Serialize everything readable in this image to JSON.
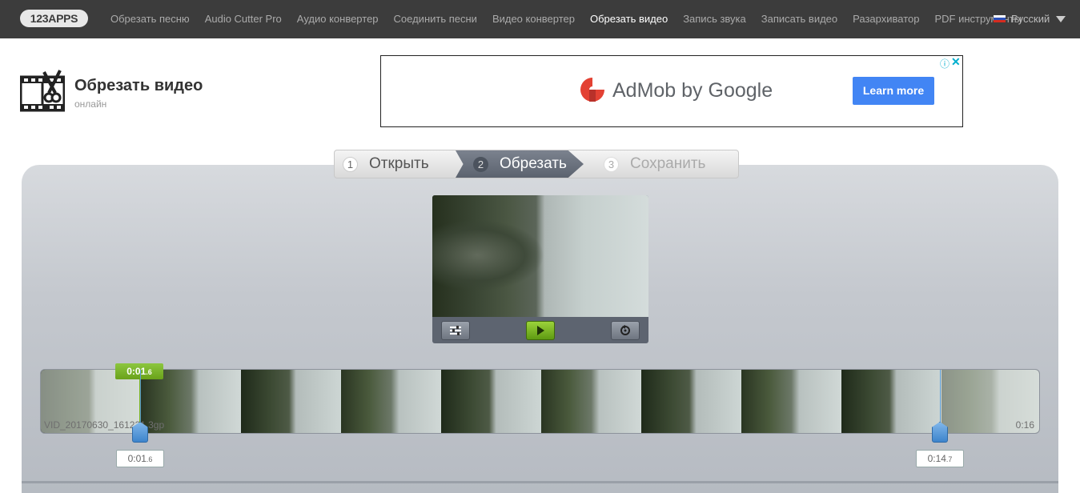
{
  "nav": {
    "logo": "123APPS",
    "items": [
      {
        "label": "Обрезать песню",
        "active": false
      },
      {
        "label": "Audio Cutter Pro",
        "active": false
      },
      {
        "label": "Аудио конвертер",
        "active": false
      },
      {
        "label": "Соединить песни",
        "active": false
      },
      {
        "label": "Видео конвертер",
        "active": false
      },
      {
        "label": "Обрезать видео",
        "active": true
      },
      {
        "label": "Запись звука",
        "active": false
      },
      {
        "label": "Записать видео",
        "active": false
      },
      {
        "label": "Разархиватор",
        "active": false
      },
      {
        "label": "PDF инструменты",
        "active": false
      }
    ],
    "language": "Русский"
  },
  "app": {
    "title": "Обрезать видео",
    "subtitle": "онлайн",
    "icon": "film-scissors-icon"
  },
  "ad": {
    "brand": "AdMob by Google",
    "button": "Learn more",
    "info_icon": "ⓘ",
    "close_icon": "✕"
  },
  "steps": [
    {
      "num": "1",
      "label": "Открыть"
    },
    {
      "num": "2",
      "label": "Обрезать"
    },
    {
      "num": "3",
      "label": "Сохранить"
    }
  ],
  "player": {
    "controls": [
      "settings-icon",
      "play-icon",
      "reset-icon"
    ]
  },
  "timeline": {
    "filename": "VID_20170630_161221.3gp",
    "duration": "0:16",
    "cursor": {
      "main": "0:01",
      "frac": ".6"
    },
    "start": {
      "main": "0:01",
      "frac": ".6"
    },
    "end": {
      "main": "0:14",
      "frac": ".7"
    }
  },
  "colors": {
    "topbar": "#3c3c3c",
    "accent_green": "#7ab31c",
    "handle_blue": "#3d84cc",
    "ad_button": "#4285f4"
  }
}
